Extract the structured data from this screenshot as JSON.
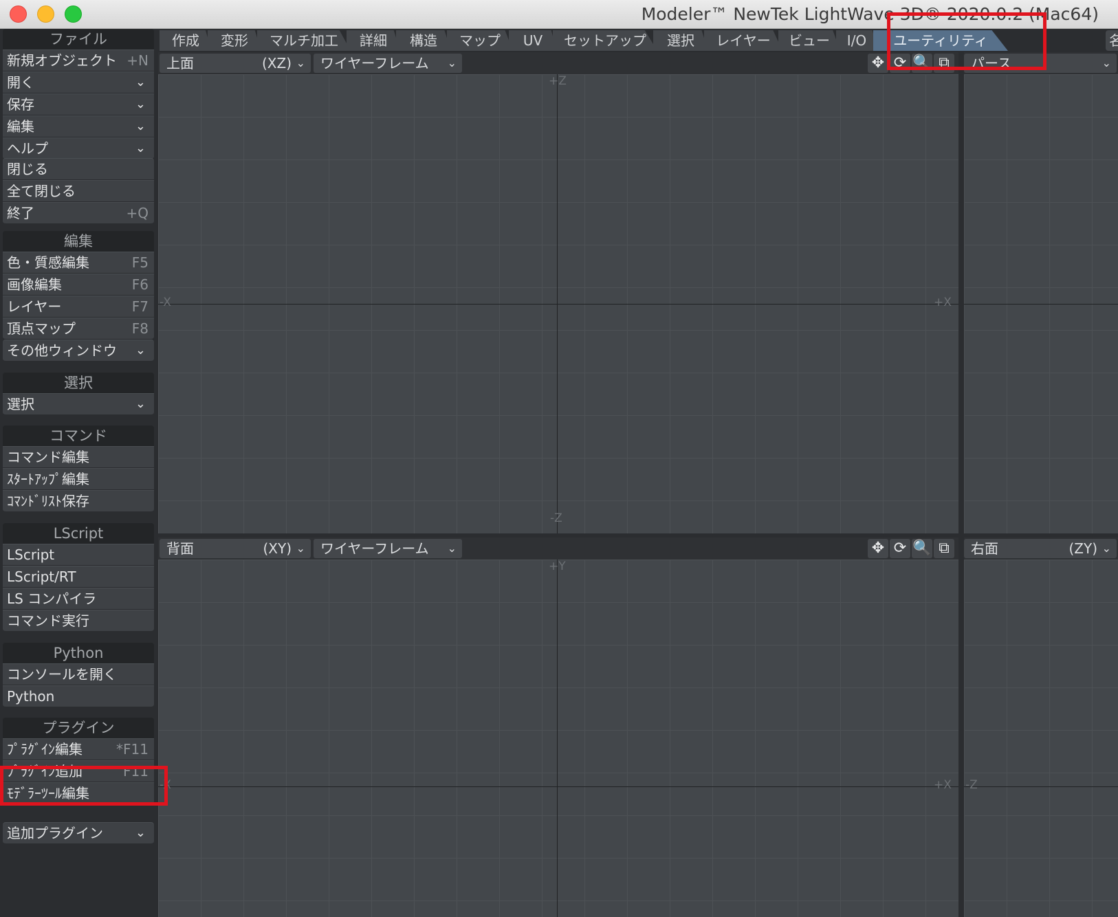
{
  "window": {
    "title": "Modeler™ NewTek LightWave 3D® 2020.0.2 (Mac64)"
  },
  "sidebar": {
    "file": {
      "header": "ファイル",
      "items": [
        {
          "label": "新規オブジェクト",
          "shortcut": "+N"
        },
        {
          "label": "開く",
          "chevron": "⌄"
        },
        {
          "label": "保存",
          "chevron": "⌄"
        },
        {
          "label": "編集",
          "chevron": "⌄"
        },
        {
          "label": "ヘルプ",
          "chevron": "⌄"
        }
      ],
      "items2": [
        {
          "label": "閉じる"
        },
        {
          "label": "全て閉じる"
        },
        {
          "label": "終了",
          "shortcut": "+Q"
        }
      ]
    },
    "edit": {
      "header": "編集",
      "items": [
        {
          "label": "色・質感編集",
          "shortcut": "F5"
        },
        {
          "label": "画像編集",
          "shortcut": "F6"
        },
        {
          "label": "レイヤー",
          "shortcut": "F7"
        },
        {
          "label": "頂点マップ",
          "shortcut": "F8"
        }
      ],
      "other": {
        "label": "その他ウィンドウ"
      }
    },
    "select": {
      "header": "選択",
      "items": [
        {
          "label": "選択"
        }
      ]
    },
    "command": {
      "header": "コマンド",
      "items": [
        {
          "label": "コマンド編集"
        },
        {
          "label": "ｽﾀｰﾄｱｯﾌﾟ編集"
        },
        {
          "label": "ｺﾏﾝﾄﾞﾘｽﾄ保存"
        }
      ]
    },
    "lscript": {
      "header": "LScript",
      "items": [
        {
          "label": "LScript"
        },
        {
          "label": "LScript/RT"
        },
        {
          "label": "LS コンパイラ"
        },
        {
          "label": "コマンド実行"
        }
      ]
    },
    "python": {
      "header": "Python",
      "items": [
        {
          "label": "コンソールを開く"
        },
        {
          "label": "Python"
        }
      ]
    },
    "plugin": {
      "header": "プラグイン",
      "items": [
        {
          "label": "ﾌﾟﾗｸﾞｲﾝ編集",
          "shortcut": "*F11"
        },
        {
          "label": "ﾌﾟﾗｸﾞｲﾝ追加",
          "shortcut": "F11"
        },
        {
          "label": "ﾓﾃﾞﾗｰﾂｰﾙ編集"
        }
      ],
      "extra": {
        "label": "追加プラグイン"
      }
    }
  },
  "tabs": [
    {
      "label": "作成"
    },
    {
      "label": "変形"
    },
    {
      "label": "マルチ加工"
    },
    {
      "label": "詳細"
    },
    {
      "label": "構造"
    },
    {
      "label": "マップ"
    },
    {
      "label": "UV"
    },
    {
      "label": "セットアップ"
    },
    {
      "label": "選択"
    },
    {
      "label": "レイヤー"
    },
    {
      "label": "ビュー"
    },
    {
      "label": "I/O"
    },
    {
      "label": "ユーティリティ",
      "active": true
    }
  ],
  "tab_extra": "名",
  "viewports": {
    "top": {
      "view": "上面",
      "axis": "(XZ)",
      "mode": "ワイヤーフレーム",
      "labels": {
        "top": "+Z",
        "bottom": "-Z",
        "left": "-X",
        "right": "+X"
      }
    },
    "perspective": {
      "view": "パース"
    },
    "back": {
      "view": "背面",
      "axis": "(XY)",
      "mode": "ワイヤーフレーム",
      "labels": {
        "top": "+Y",
        "left": "-X",
        "right": "+X"
      }
    },
    "right": {
      "view": "右面",
      "axis": "(ZY)",
      "labels": {
        "left": "-Z"
      }
    }
  },
  "tools": {
    "move": "✥",
    "rotate": "⟳",
    "zoom": "🔍",
    "maximize": "⧉"
  },
  "colors": {
    "active_tab": "#57708a",
    "highlight": "#e0141e"
  }
}
